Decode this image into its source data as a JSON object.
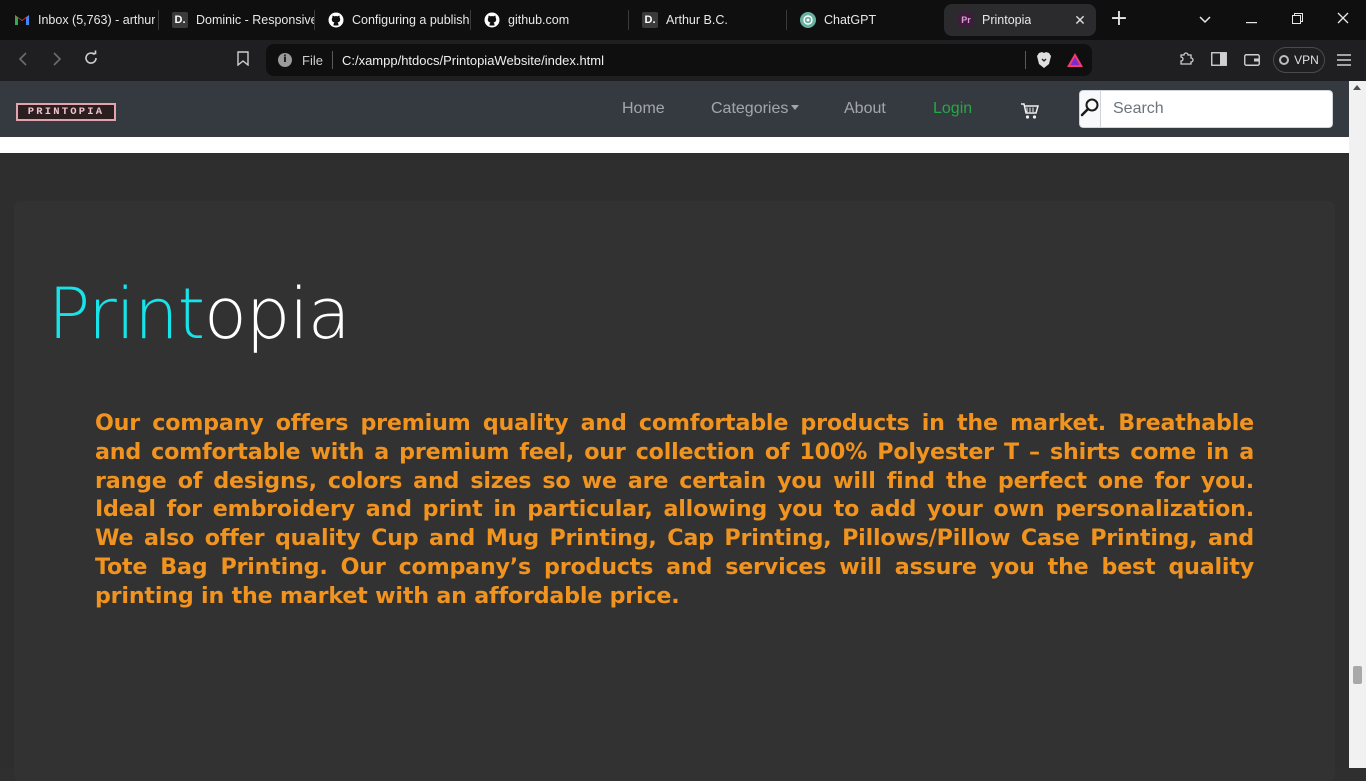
{
  "browser": {
    "tabs": [
      {
        "title": "Inbox (5,763) - arthur",
        "favicon": "gmail-icon"
      },
      {
        "title": "Dominic - Responsive",
        "favicon": "d-icon"
      },
      {
        "title": "Configuring a publish",
        "favicon": "github-icon"
      },
      {
        "title": "github.com",
        "favicon": "github-icon"
      },
      {
        "title": "Arthur B.C.",
        "favicon": "d-icon"
      },
      {
        "title": "ChatGPT",
        "favicon": "chatgpt-icon"
      },
      {
        "title": "Printopia",
        "favicon": "printopia-icon",
        "active": true
      }
    ],
    "url_scheme": "File",
    "url": "C:/xampp/htdocs/PrintopiaWebsite/index.html",
    "vpn_label": "VPN"
  },
  "site": {
    "logo_text": "PRINTOPIA",
    "nav": {
      "home": "Home",
      "categories": "Categories",
      "about": "About",
      "login": "Login"
    },
    "search": {
      "placeholder": "Search"
    },
    "hero": {
      "title_part1": "Print",
      "title_part2": "opia",
      "text": "Our company offers premium quality and comfortable products in the market. Breathable and comfortable with a premium feel, our collection of 100% Polyester T – shirts come in a range of designs, colors and sizes so we are certain you will find the perfect one for you. Ideal for embroidery and print in particular, allowing you to add your own personalization. We also offer quality Cup and Mug Printing, Cap Printing, Pillows/Pillow Case Printing, and Tote Bag Printing. Our company’s products and services will assure you the best quality printing in the market with an affordable price."
    }
  },
  "colors": {
    "navbar": "#343a40",
    "hero_accent": "#17e3e9",
    "hero_text": "#f0931f",
    "login": "#28a745",
    "jumbotron": "#323232"
  }
}
